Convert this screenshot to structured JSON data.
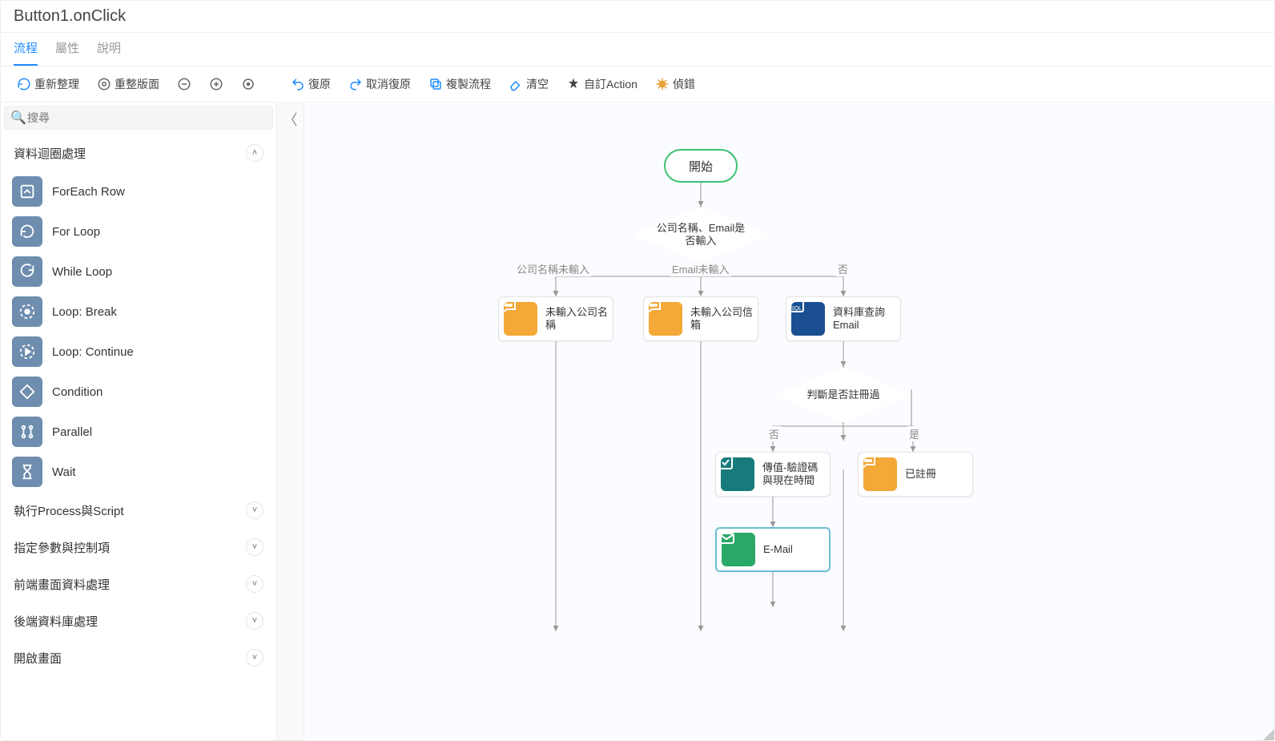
{
  "title": "Button1.onClick",
  "tabs": [
    "流程",
    "屬性",
    "說明"
  ],
  "toolbar": {
    "refresh": "重新整理",
    "layout": "重整版面",
    "undo": "復原",
    "redo": "取消復原",
    "copy": "複製流程",
    "clear": "清空",
    "custom": "自訂Action",
    "debug": "偵錯"
  },
  "search": {
    "placeholder": "搜尋"
  },
  "sidebar": {
    "cat1": {
      "title": "資料迴圈處理"
    },
    "items": {
      "foreach": "ForEach Row",
      "forloop": "For Loop",
      "while": "While Loop",
      "break": "Loop: Break",
      "continue": "Loop: Continue",
      "condition": "Condition",
      "parallel": "Parallel",
      "wait": "Wait"
    },
    "collapsed": {
      "c1": "執行Process與Script",
      "c2": "指定參數與控制項",
      "c3": "前端畫面資料處理",
      "c4": "後端資料庫處理",
      "c5": "開啟畫面"
    }
  },
  "flow": {
    "start": "開始",
    "cond1": "公司名稱、Email是否輸入",
    "branchLabels": {
      "l": "公司名稱未輸入",
      "m": "Email未輸入",
      "r": "否"
    },
    "n1": "未輸入公司名稱",
    "n2": "未輸入公司信箱",
    "n3top": "資料庫查詢",
    "n3bot": "Email",
    "cond2": "判斷是否註冊過",
    "branch2": {
      "l": "否",
      "r": "是"
    },
    "n4": "傳值-驗證碼與現在時間",
    "n5": "已註冊",
    "n6": "E-Mail"
  },
  "colors": {
    "accent": "#1f8cff",
    "start": "#3cc173"
  }
}
